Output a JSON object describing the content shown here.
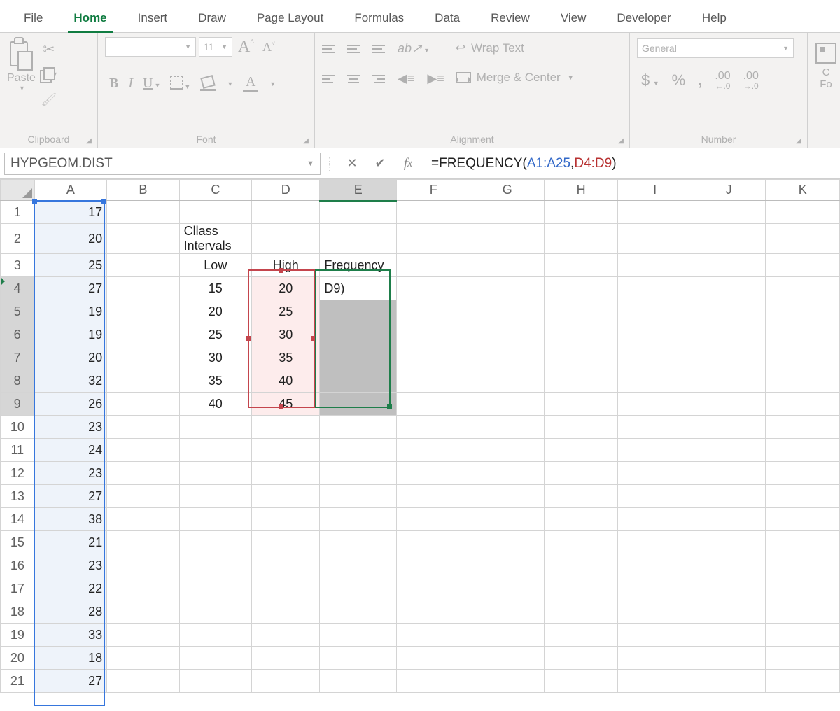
{
  "tabs": {
    "file": "File",
    "home": "Home",
    "insert": "Insert",
    "draw": "Draw",
    "page_layout": "Page Layout",
    "formulas": "Formulas",
    "data": "Data",
    "review": "Review",
    "view": "View",
    "developer": "Developer",
    "help": "Help"
  },
  "ribbon": {
    "clipboard": {
      "paste": "Paste",
      "label": "Clipboard"
    },
    "font": {
      "size": "11",
      "label": "Font",
      "bold": "B",
      "italic": "I",
      "underline": "U",
      "fontcolor": "A"
    },
    "alignment": {
      "label": "Alignment",
      "wrap": "Wrap Text",
      "merge": "Merge & Center"
    },
    "number": {
      "label": "Number",
      "format": "General",
      "dollar": "$",
      "percent": "%",
      "comma": ","
    },
    "cond": {
      "line1": "C",
      "line2": "Fo"
    }
  },
  "name_box": "HYPGEOM.DIST",
  "formula": {
    "prefix": "=FREQUENCY(",
    "range1": "A1:A25",
    "comma": ",",
    "range2": "D4:D9",
    "suffix": ")"
  },
  "columns": [
    "A",
    "B",
    "C",
    "D",
    "E",
    "F",
    "G",
    "H",
    "I",
    "J",
    "K"
  ],
  "data_A": [
    17,
    20,
    25,
    27,
    19,
    19,
    20,
    32,
    26,
    23,
    24,
    23,
    27,
    38,
    21,
    23,
    22,
    28,
    33,
    18,
    27
  ],
  "labels": {
    "class_intervals": "Cllass Intervals",
    "low": "Low",
    "high": "High",
    "frequency": "Frequency"
  },
  "low": [
    15,
    20,
    25,
    30,
    35,
    40
  ],
  "high": [
    20,
    25,
    30,
    35,
    40,
    45
  ],
  "e4_text": "D9)"
}
